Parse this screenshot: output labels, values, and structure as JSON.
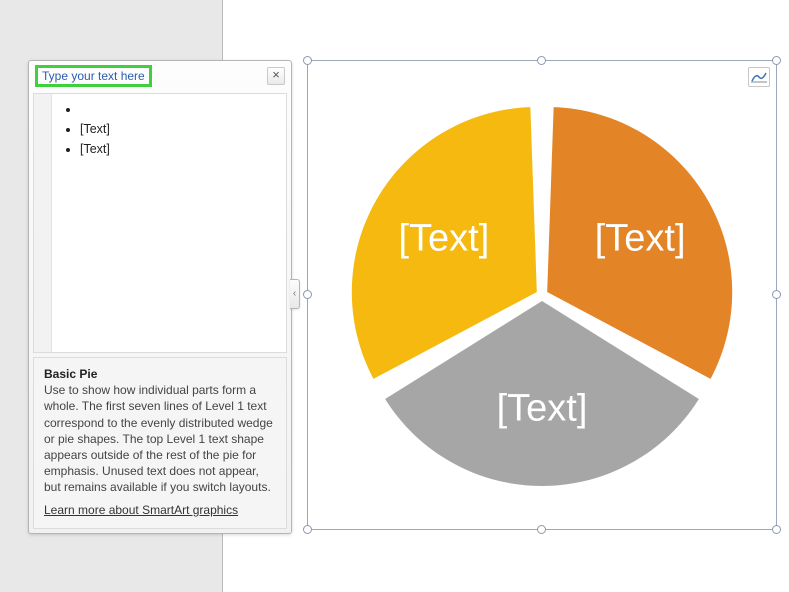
{
  "text_pane": {
    "title": "Type your text here",
    "items": [
      "",
      "[Text]",
      "[Text]"
    ],
    "desc_title": "Basic Pie",
    "desc_body": "Use to show how individual parts form a whole. The first seven lines of Level 1 text correspond to the evenly distributed wedge or pie shapes. The top Level 1 text shape appears outside of the rest of the pie for emphasis. Unused text does not appear, but remains available if you switch layouts.",
    "link": "Learn more about SmartArt graphics"
  },
  "chart_data": {
    "type": "pie",
    "title": "",
    "slices": [
      {
        "label": "[Text]",
        "value": 1,
        "color": "#e38427"
      },
      {
        "label": "[Text]",
        "value": 1,
        "color": "#a6a6a6"
      },
      {
        "label": "[Text]",
        "value": 1,
        "color": "#f5b90f"
      }
    ],
    "gap_deg": 4,
    "start_deg": -90
  }
}
